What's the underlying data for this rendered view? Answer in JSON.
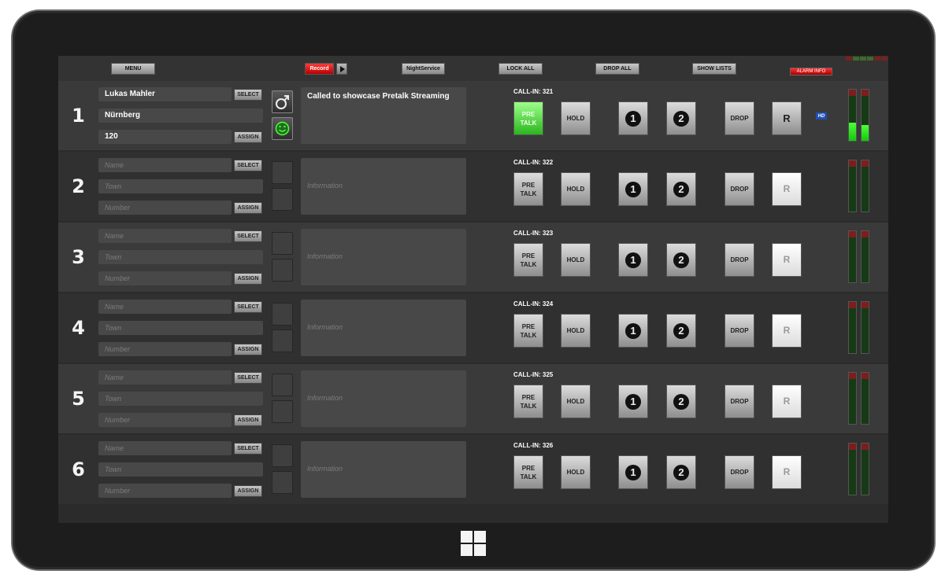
{
  "toolbar": {
    "menu": "MENU",
    "record": "Record",
    "night_service": "NightService",
    "lock_all": "LOCK ALL",
    "drop_all": "DROP ALL",
    "show_lists": "SHOW LISTS",
    "alarm_info": "ALARM INFO"
  },
  "labels": {
    "select": "SELECT",
    "assign": "ASSIGN",
    "pre_talk_1": "PRE",
    "pre_talk_2": "TALK",
    "hold": "HOLD",
    "drop": "DROP",
    "r": "R",
    "hd": "HD",
    "line1": "1",
    "line2": "2"
  },
  "colors": {
    "pretalk_active": "#2bb51e",
    "record": "#d40000",
    "alarm": "#c00000",
    "meter": "#13c80c",
    "hd": "#1f4fb5"
  },
  "lines": [
    {
      "num": "1",
      "name": "Lukas Mahler",
      "town": "Nürnberg",
      "number": "120",
      "info": "Called to showcase Pretalk Streaming",
      "callin": "CALL-IN: 321",
      "active": true,
      "level_left": 0.35,
      "level_right": 0.3
    },
    {
      "num": "2",
      "name": "Name",
      "town": "Town",
      "number": "Number",
      "info": "Information",
      "callin": "CALL-IN: 322",
      "active": false,
      "level_left": 0,
      "level_right": 0
    },
    {
      "num": "3",
      "name": "Name",
      "town": "Town",
      "number": "Number",
      "info": "Information",
      "callin": "CALL-IN: 323",
      "active": false,
      "level_left": 0,
      "level_right": 0
    },
    {
      "num": "4",
      "name": "Name",
      "town": "Town",
      "number": "Number",
      "info": "Information",
      "callin": "CALL-IN: 324",
      "active": false,
      "level_left": 0,
      "level_right": 0
    },
    {
      "num": "5",
      "name": "Name",
      "town": "Town",
      "number": "Number",
      "info": "Information",
      "callin": "CALL-IN: 325",
      "active": false,
      "level_left": 0,
      "level_right": 0
    },
    {
      "num": "6",
      "name": "Name",
      "town": "Town",
      "number": "Number",
      "info": "Information",
      "callin": "CALL-IN: 326",
      "active": false,
      "level_left": 0,
      "level_right": 0
    }
  ]
}
